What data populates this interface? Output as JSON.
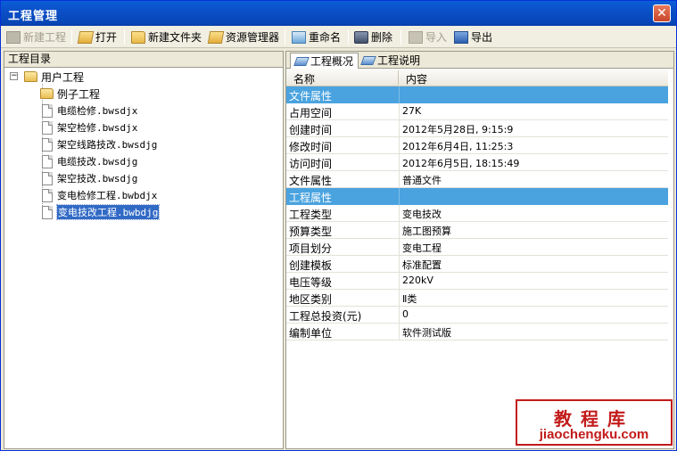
{
  "window": {
    "title": "工程管理"
  },
  "toolbar": {
    "new_project": "新建工程",
    "open": "打开",
    "new_folder": "新建文件夹",
    "resource_manager": "资源管理器",
    "rename": "重命名",
    "delete": "删除",
    "import": "导入",
    "export": "导出"
  },
  "tree": {
    "header": "工程目录",
    "root": "用户工程",
    "expander": "−",
    "items": [
      {
        "label": "例子工程",
        "type": "folder"
      },
      {
        "label": "电缆检修.bwsdjx",
        "type": "file"
      },
      {
        "label": "架空检修.bwsdjx",
        "type": "file"
      },
      {
        "label": "架空线路技改.bwsdjg",
        "type": "file"
      },
      {
        "label": "电缆技改.bwsdjg",
        "type": "file"
      },
      {
        "label": "架空技改.bwsdjg",
        "type": "file"
      },
      {
        "label": "变电检修工程.bwbdjx",
        "type": "file"
      },
      {
        "label": "变电技改工程.bwbdjg",
        "type": "file",
        "selected": true
      }
    ]
  },
  "tabs": [
    {
      "label": "工程概况",
      "active": true
    },
    {
      "label": "工程说明",
      "active": false
    }
  ],
  "grid": {
    "col_name": "名称",
    "col_content": "内容",
    "rows": [
      {
        "k": "文件属性",
        "v": "",
        "section": true
      },
      {
        "k": "占用空间",
        "v": "27K"
      },
      {
        "k": "创建时间",
        "v": "2012年5月28日, 9:15:9"
      },
      {
        "k": "修改时间",
        "v": "2012年6月4日, 11:25:3"
      },
      {
        "k": "访问时间",
        "v": "2012年6月5日, 18:15:49"
      },
      {
        "k": "文件属性",
        "v": "普通文件"
      },
      {
        "k": "工程属性",
        "v": "",
        "section": true
      },
      {
        "k": "工程类型",
        "v": "变电技改"
      },
      {
        "k": "预算类型",
        "v": "施工图预算"
      },
      {
        "k": "项目划分",
        "v": "变电工程"
      },
      {
        "k": "创建模板",
        "v": "标准配置"
      },
      {
        "k": "电压等级",
        "v": "220kV"
      },
      {
        "k": "地区类别",
        "v": "Ⅱ类"
      },
      {
        "k": "工程总投资(元)",
        "v": "0"
      },
      {
        "k": "编制单位",
        "v": "软件测试版"
      }
    ]
  },
  "watermark": {
    "line1": "教程库",
    "line2": "jiaochengku.com"
  },
  "colors": {
    "title_bar": "#0a5fd6",
    "section_row": "#4aa3df",
    "selection": "#316ac5",
    "watermark": "#c21a1a"
  }
}
